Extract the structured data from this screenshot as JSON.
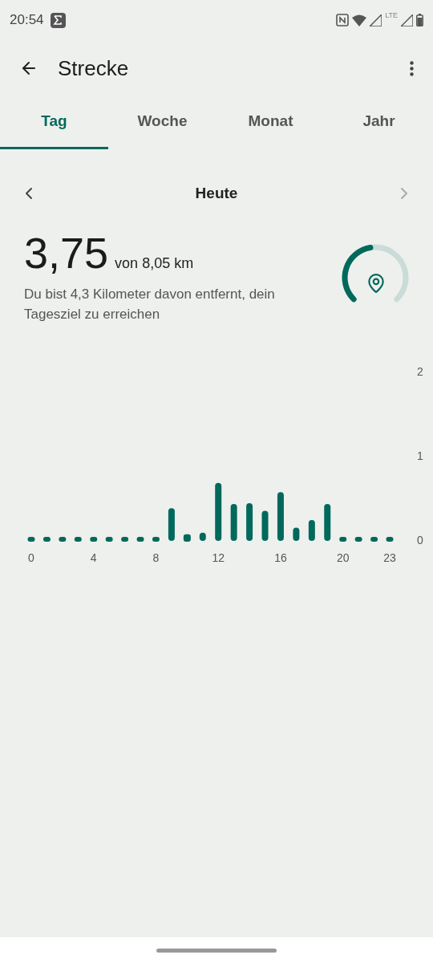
{
  "status_bar": {
    "time": "20:54",
    "network": "LTE"
  },
  "app_bar": {
    "title": "Strecke"
  },
  "tabs": [
    {
      "label": "Tag",
      "selected": true
    },
    {
      "label": "Woche",
      "selected": false
    },
    {
      "label": "Monat",
      "selected": false
    },
    {
      "label": "Jahr",
      "selected": false
    }
  ],
  "period": {
    "label": "Heute"
  },
  "summary": {
    "value": "3,75",
    "goal": "von 8,05 km",
    "message": "Du bist 4,3 Kilometer davon entfernt, dein Tagesziel zu erreichen"
  },
  "chart_data": {
    "type": "bar",
    "x": [
      0,
      1,
      2,
      3,
      4,
      5,
      6,
      7,
      8,
      9,
      10,
      11,
      12,
      13,
      14,
      15,
      16,
      17,
      18,
      19,
      20,
      21,
      22,
      23
    ],
    "series": [
      {
        "color": "#00695c",
        "values": [
          0,
          0,
          0,
          0,
          0,
          0,
          0,
          0,
          0,
          0.35,
          0.03,
          0.06,
          0.65,
          0.4,
          0.41,
          0.32,
          0.54,
          0.12,
          0.21,
          0.4,
          0,
          0,
          0,
          0
        ]
      }
    ],
    "xticks": [
      {
        "value": 0,
        "label": "0"
      },
      {
        "value": 4,
        "label": "4"
      },
      {
        "value": 8,
        "label": "8"
      },
      {
        "value": 12,
        "label": "12"
      },
      {
        "value": 16,
        "label": "16"
      },
      {
        "value": 20,
        "label": "20"
      },
      {
        "value": 23,
        "label": "23"
      }
    ],
    "xlim": [
      0,
      23
    ],
    "yticks": [
      0,
      1,
      2
    ],
    "ylim": [
      0,
      2
    ]
  }
}
